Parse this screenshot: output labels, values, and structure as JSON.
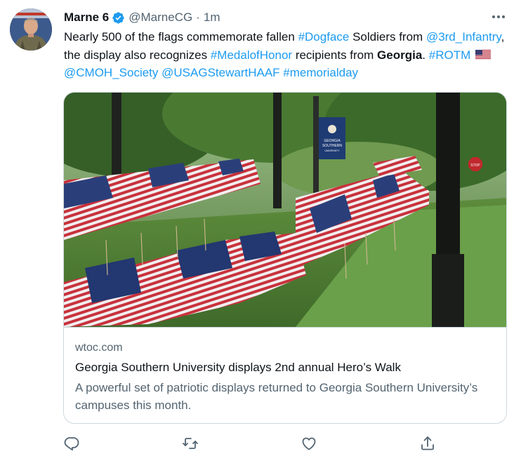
{
  "tweet": {
    "author_name": "Marne 6",
    "handle": "@MarneCG",
    "separator": "·",
    "time": "1m",
    "text_segments": [
      {
        "t": "Nearly 500 of the flags commemorate fallen "
      },
      {
        "t": "#Dogface",
        "link": true
      },
      {
        "t": " Soldiers from "
      },
      {
        "t": "@3rd_Infantry",
        "link": true
      },
      {
        "t": ", the display also recognizes "
      },
      {
        "t": "#MedalofHonor",
        "link": true
      },
      {
        "t": " recipients from "
      },
      {
        "t": "Georgia",
        "bold": true
      },
      {
        "t": ". "
      },
      {
        "t": "#ROTM",
        "link": true
      },
      {
        "t": " "
      },
      {
        "emoji": "us-flag"
      },
      {
        "t": " "
      },
      {
        "t": "@CMOH_Society",
        "link": true
      },
      {
        "t": " "
      },
      {
        "t": "@USAGStewartHAAF",
        "link": true
      },
      {
        "t": " "
      },
      {
        "t": "#memorialday",
        "link": true
      }
    ]
  },
  "card": {
    "image_subject": "rows of american flags on a campus lawn",
    "banner_text": [
      "GEORGIA",
      "SOUTHERN",
      "UNIVERSITY"
    ],
    "sign_text": "STOP",
    "domain": "wtoc.com",
    "title": "Georgia Southern University displays 2nd annual Hero’s Walk",
    "description": "A powerful set of patriotic displays returned to Georgia Southern University’s campuses this month."
  },
  "icons": {
    "verified": "verified-badge-icon",
    "more": "more-options-icon",
    "reply": "reply-icon",
    "retweet": "retweet-icon",
    "like": "like-icon",
    "share": "share-icon"
  },
  "colors": {
    "link": "#1d9bf0",
    "secondary_text": "#536471",
    "border": "#cfd9de",
    "verified": "#1d9bf0"
  }
}
